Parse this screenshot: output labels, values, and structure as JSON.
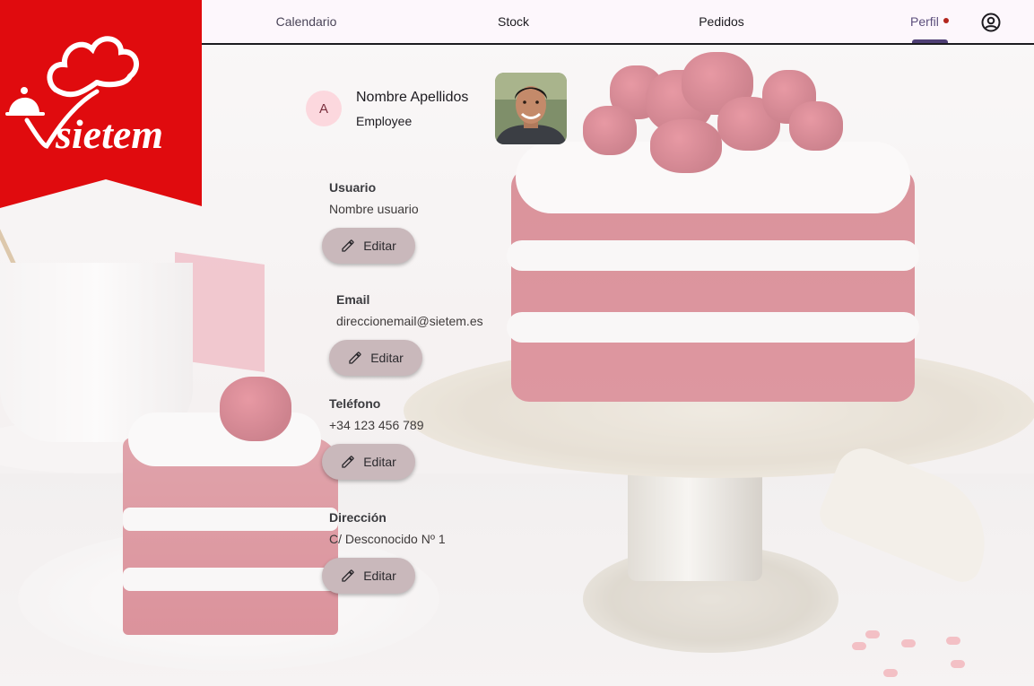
{
  "brand": {
    "logo_text": "sietem",
    "logo_color": "#e00b0e"
  },
  "nav": {
    "tabs": [
      {
        "label": "Calendario"
      },
      {
        "label": "Stock"
      },
      {
        "label": "Pedidos"
      },
      {
        "label": "Perfil",
        "active": true,
        "badge": true
      }
    ],
    "account_icon": "account-circle-icon"
  },
  "profile": {
    "initial": "A",
    "name": "Nombre Apellidos",
    "role": "Employee",
    "photo_icon": "user-photo"
  },
  "fields": [
    {
      "label": "Usuario",
      "value": "Nombre usuario",
      "button": "Editar"
    },
    {
      "label": "Email",
      "value": "direccionemail@sietem.es",
      "button": "Editar"
    },
    {
      "label": "Teléfono",
      "value": "+34 123 456 789",
      "button": "Editar"
    },
    {
      "label": "Dirección",
      "value": "C/ Desconocido Nº 1",
      "button": "Editar"
    }
  ],
  "colors": {
    "accent": "#4f3f75",
    "button_bg": "#c9b8bb",
    "badge": "#b3261e",
    "avatar_bg": "#fcd8de"
  },
  "edit_icon": "pencil-icon"
}
